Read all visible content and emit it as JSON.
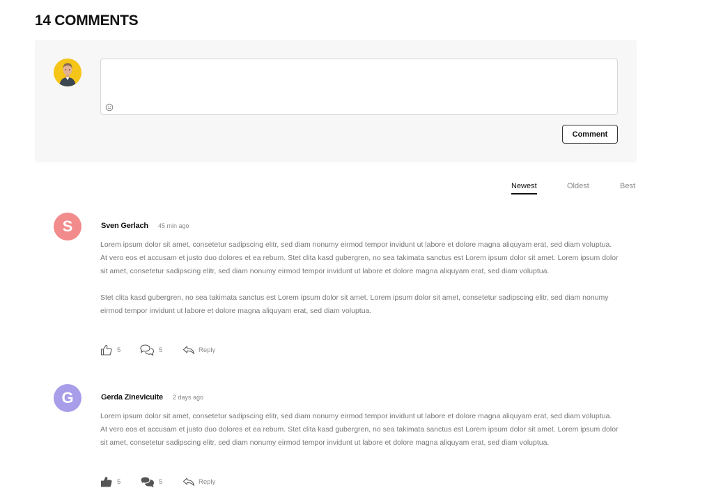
{
  "header": {
    "title": "14 COMMENTS"
  },
  "composer": {
    "avatar_icon": "user-photo-avatar",
    "placeholder": "",
    "emoji_icon": "smiley-icon",
    "submit_label": "Comment"
  },
  "sort": {
    "tabs": [
      "Newest",
      "Oldest",
      "Best"
    ],
    "active": "Newest"
  },
  "comments": [
    {
      "initial": "S",
      "avatar_color": "#f28b8b",
      "author": "Sven Gerlach",
      "time": "45 min ago",
      "paragraphs": [
        "Lorem ipsum dolor sit amet, consetetur sadipscing elitr, sed diam nonumy eirmod tempor invidunt ut labore et dolore magna aliquyam erat, sed diam voluptua. At vero eos et accusam et justo duo dolores et ea rebum. Stet clita kasd gubergren, no sea takimata sanctus est Lorem ipsum dolor sit amet. Lorem ipsum dolor sit amet, consetetur sadipscing elitr, sed diam nonumy eirmod tempor invidunt ut labore et dolore magna aliquyam erat, sed diam voluptua.",
        "Stet clita kasd gubergren, no sea takimata sanctus est Lorem ipsum dolor sit amet. Lorem ipsum dolor sit amet, consetetur sadipscing elitr, sed diam nonumy eirmod tempor invidunt ut labore et dolore magna aliquyam erat, sed diam voluptua."
      ],
      "likes": "5",
      "replies": "5",
      "reply_label": "Reply",
      "like_icon": "thumbs-up-outline-icon",
      "reply_count_icon": "chat-bubbles-outline-icon",
      "reply_icon": "reply-arrow-icon"
    },
    {
      "initial": "G",
      "avatar_color": "#a89de8",
      "author": "Gerda Zinevicuite",
      "time": "2 days ago",
      "paragraphs": [
        "Lorem ipsum dolor sit amet, consetetur sadipscing elitr, sed diam nonumy eirmod tempor invidunt ut labore et dolore magna aliquyam erat, sed diam voluptua. At vero eos et accusam et justo duo dolores et ea rebum. Stet clita kasd gubergren, no sea takimata sanctus est Lorem ipsum dolor sit amet. Lorem ipsum dolor sit amet, consetetur sadipscing elitr, sed diam nonumy eirmod tempor invidunt ut labore et dolore magna aliquyam erat, sed diam voluptua."
      ],
      "likes": "5",
      "replies": "5",
      "reply_label": "Reply",
      "like_icon": "thumbs-up-filled-icon",
      "reply_count_icon": "chat-bubbles-filled-icon",
      "reply_icon": "reply-arrow-icon"
    }
  ]
}
